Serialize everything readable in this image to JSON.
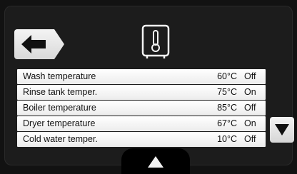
{
  "toolbar": {
    "back_icon": "arrow-left-icon",
    "title_icon": "thermometer-icon"
  },
  "rows": [
    {
      "name": "Wash temperature",
      "value": "60°C",
      "state": "Off"
    },
    {
      "name": "Rinse tank temper.",
      "value": "75°C",
      "state": "On"
    },
    {
      "name": "Boiler temperature",
      "value": "85°C",
      "state": "Off"
    },
    {
      "name": "Dryer temperature",
      "value": "67°C",
      "state": "On"
    },
    {
      "name": "Cold water temper.",
      "value": "10°C",
      "state": "Off"
    }
  ],
  "nav": {
    "down_icon": "triangle-down-icon",
    "up_icon": "triangle-up-icon"
  },
  "colors": {
    "background": "#121212",
    "row_bg": "#ffffff",
    "button_bg": "#e6e6e6",
    "text": "#111111"
  }
}
